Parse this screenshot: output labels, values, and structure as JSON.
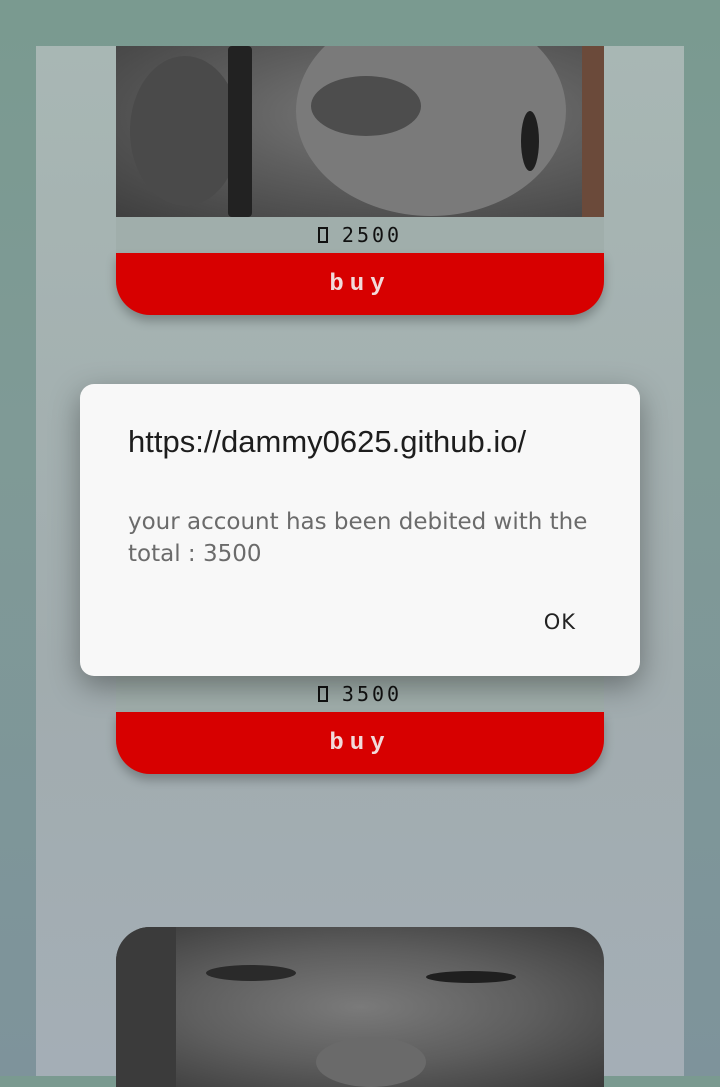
{
  "products": [
    {
      "price": "2500",
      "buy_label": "buy"
    },
    {
      "price": "3500",
      "buy_label": "buy"
    }
  ],
  "dialog": {
    "title": "https://dammy0625.github.io/",
    "message": "your account has been debited with the total : 3500",
    "ok_label": "OK"
  },
  "colors": {
    "buy_button": "#d70000",
    "dialog_bg": "#f8f8f8"
  }
}
